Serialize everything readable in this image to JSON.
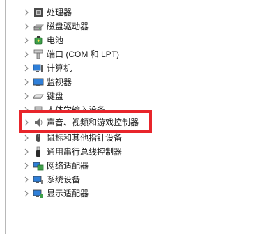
{
  "device_tree": {
    "items": [
      {
        "label": "处理器",
        "icon": "cpu-icon"
      },
      {
        "label": "磁盘驱动器",
        "icon": "disk-drive-icon"
      },
      {
        "label": "电池",
        "icon": "battery-icon"
      },
      {
        "label": "端口 (COM 和 LPT)",
        "icon": "port-icon"
      },
      {
        "label": "计算机",
        "icon": "computer-icon"
      },
      {
        "label": "监视器",
        "icon": "monitor-icon"
      },
      {
        "label": "键盘",
        "icon": "keyboard-icon"
      },
      {
        "label": "人体学输入设备",
        "icon": "hid-icon"
      },
      {
        "label": "声音、视频和游戏控制器",
        "icon": "speaker-icon"
      },
      {
        "label": "鼠标和其他指针设备",
        "icon": "mouse-icon"
      },
      {
        "label": "通用串行总线控制器",
        "icon": "usb-icon"
      },
      {
        "label": "网络适配器",
        "icon": "network-adapter-icon"
      },
      {
        "label": "系统设备",
        "icon": "system-device-icon"
      },
      {
        "label": "显示适配器",
        "icon": "display-adapter-icon"
      }
    ],
    "highlight_color": "#e8252b"
  }
}
